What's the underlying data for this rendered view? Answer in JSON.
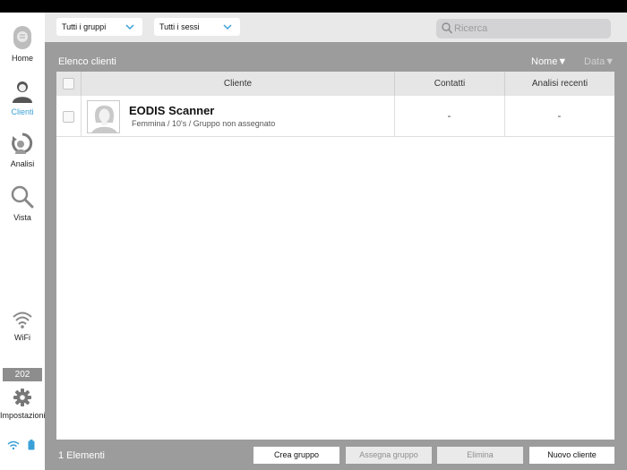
{
  "sidebar": {
    "home_label": "Home",
    "clients_label": "Clienti",
    "analysis_label": "Analisi",
    "view_label": "Vista",
    "wifi_label": "WiFi",
    "badge_number": "202",
    "settings_label": "Impostazioni"
  },
  "topbar": {
    "groups_filter": "Tutti i gruppi",
    "sex_filter": "Tutti i sessi",
    "search_placeholder": "Ricerca"
  },
  "list": {
    "title": "Elenco clienti",
    "sort_name": "Nome▼",
    "sort_date": "Data▼",
    "columns": [
      "Cliente",
      "Contatti",
      "Analisi recenti"
    ],
    "rows": [
      {
        "name": "EODIS Scanner",
        "details": "Femmina / 10's / Gruppo non assegnato",
        "contacts": "-",
        "recent_analysis": "-"
      }
    ]
  },
  "footer": {
    "count": "1 Elementi",
    "create_group": "Crea gruppo",
    "assign_group": "Assegna gruppo",
    "delete": "Elimina",
    "new_client": "Nuovo cliente"
  },
  "colors": {
    "accent": "#3aa0d8",
    "main_bg": "#9c9c9c",
    "header_bg": "#e6e6e6"
  }
}
